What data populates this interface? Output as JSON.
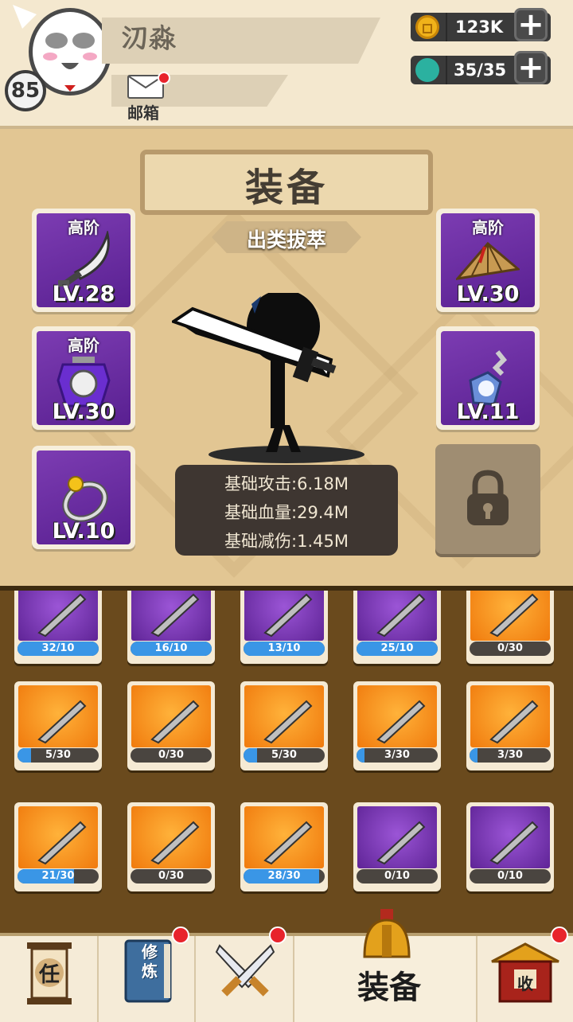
{
  "header": {
    "player_level": "85",
    "player_name": "𣱼淼",
    "mail_label": "邮箱",
    "gold": "123K",
    "stamina": "35/35"
  },
  "panel": {
    "title": "装备",
    "subtitle": "出类拔萃",
    "slots": [
      {
        "tier": "高阶",
        "level": "LV.28",
        "icon": "broadsword-icon"
      },
      {
        "tier": "高阶",
        "level": "LV.30",
        "icon": "armor-icon"
      },
      {
        "tier": "",
        "level": "LV.10",
        "icon": "ring-icon"
      },
      {
        "tier": "高阶",
        "level": "LV.30",
        "icon": "bamboo-hat-icon"
      },
      {
        "tier": "",
        "level": "LV.11",
        "icon": "amulet-icon"
      }
    ],
    "stats": [
      "基础攻击:6.18M",
      "基础血量:29.4M",
      "基础减伤:1.45M"
    ]
  },
  "inventory": {
    "rows": [
      [
        {
          "count": "32/10",
          "bg": "purple",
          "progress": 1.0
        },
        {
          "count": "16/10",
          "bg": "purple",
          "progress": 1.0
        },
        {
          "count": "13/10",
          "bg": "purple",
          "progress": 1.0
        },
        {
          "count": "25/10",
          "bg": "purple",
          "progress": 1.0
        },
        {
          "count": "0/30",
          "bg": "orange",
          "progress": 0.0
        }
      ],
      [
        {
          "count": "5/30",
          "bg": "orange",
          "progress": 0.17
        },
        {
          "count": "0/30",
          "bg": "orange",
          "progress": 0.0
        },
        {
          "count": "5/30",
          "bg": "orange",
          "progress": 0.17
        },
        {
          "count": "3/30",
          "bg": "orange",
          "progress": 0.1
        },
        {
          "count": "3/30",
          "bg": "orange",
          "progress": 0.1
        }
      ],
      [
        {
          "count": "21/30",
          "bg": "orange",
          "progress": 0.7
        },
        {
          "count": "0/30",
          "bg": "orange",
          "progress": 0.0
        },
        {
          "count": "28/30",
          "bg": "orange",
          "progress": 0.93
        },
        {
          "count": "0/10",
          "bg": "purple",
          "progress": 0.0
        },
        {
          "count": "0/10",
          "bg": "purple",
          "progress": 0.0
        }
      ]
    ]
  },
  "bottom_nav": {
    "task_label": "任",
    "cultivate_label": "修炼",
    "equip_label": "装备",
    "shop_label": "收"
  }
}
